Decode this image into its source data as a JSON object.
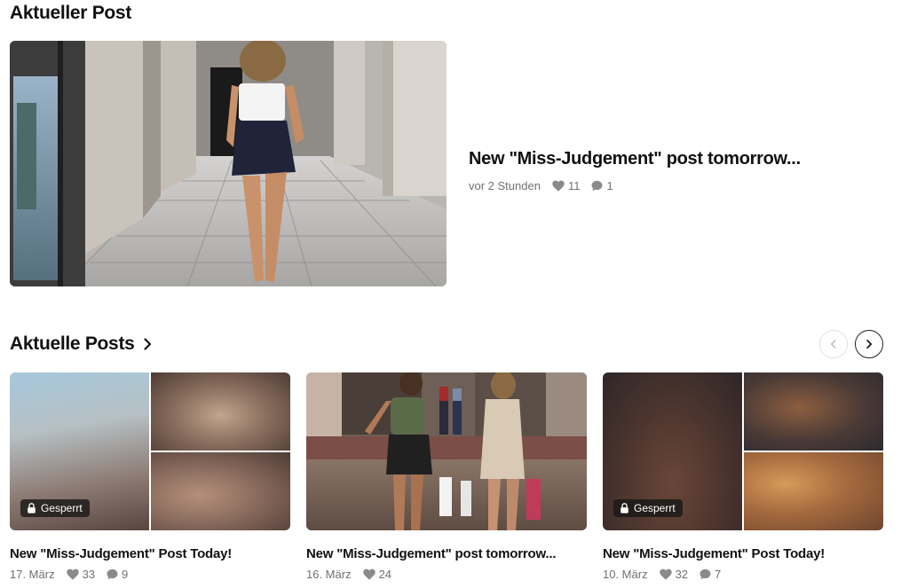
{
  "featured": {
    "section_title": "Aktueller Post",
    "title": "New \"Miss-Judgement\" post tomorrow...",
    "time": "vor 2 Stunden",
    "likes": "11",
    "comments": "1"
  },
  "recent": {
    "section_title": "Aktuelle Posts",
    "posts": [
      {
        "title": "New \"Miss-Judgement\" Post Today!",
        "date": "17. März",
        "likes": "33",
        "comments": "9",
        "badge": "Gesperrt"
      },
      {
        "title": "New \"Miss-Judgement\" post tomorrow...",
        "date": "16. März",
        "likes": "24"
      },
      {
        "title": "New \"Miss-Judgement\" Post Today!",
        "date": "10. März",
        "likes": "32",
        "comments": "7",
        "badge": "Gesperrt"
      }
    ]
  },
  "icons": {
    "like": "heart-icon",
    "comment": "speech-bubble-icon",
    "locked": "lock-icon",
    "section_link": "chevron-right-icon",
    "carousel_prev": "chevron-left-icon",
    "carousel_next": "chevron-right-icon"
  },
  "colors": {
    "text": "#111111",
    "meta_text": "#707070",
    "badge_bg": "#191919"
  }
}
